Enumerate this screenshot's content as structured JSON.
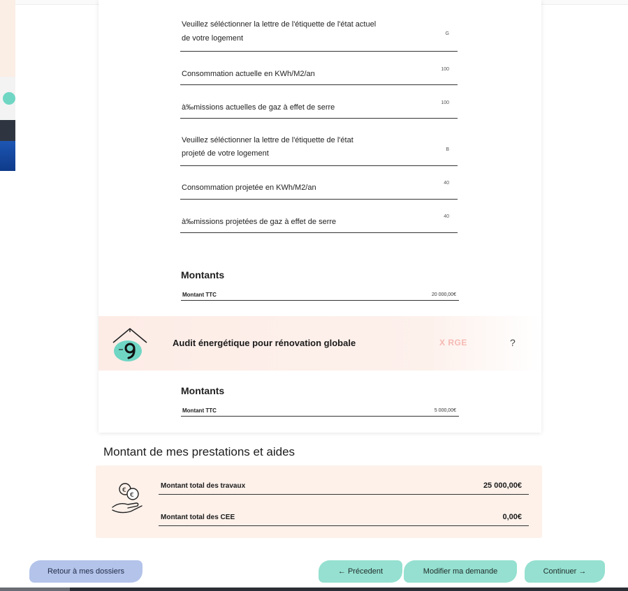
{
  "form_fields": [
    {
      "label_line1": "Veuillez séléctionner la lettre de l'étiquette de l'état actuel",
      "label_line2": "de votre logement",
      "value": "G"
    },
    {
      "label_line1": "Consommation actuelle en KWh/M2/an",
      "label_line2": "",
      "value": "100"
    },
    {
      "label_line1": "à‰missions actuelles de gaz à  effet de serre",
      "label_line2": "",
      "value": "100"
    },
    {
      "label_line1": "Veuillez séléctionner la lettre de l'étiquette de l'état",
      "label_line2": "projeté de votre logement",
      "value": "B"
    },
    {
      "label_line1": "Consommation projetée en KWh/M2/an",
      "label_line2": "",
      "value": "40"
    },
    {
      "label_line1": "à‰missions projetées de gaz à  effet de serre",
      "label_line2": "",
      "value": "40"
    }
  ],
  "section1": {
    "title": "Montants",
    "row_label": "Montant TTC",
    "row_value": "20 000,00€"
  },
  "audit": {
    "icon": "house-energy-icon",
    "title": "Audit énergétique pour rénovation globale",
    "badge": "X RGE",
    "help": "?"
  },
  "section2": {
    "title": "Montants",
    "row_label": "Montant TTC",
    "row_value": "5 000,00€"
  },
  "summary": {
    "heading": "Montant de mes prestations et aides",
    "icon": "hand-money-icon",
    "rows": [
      {
        "label": "Montant total des travaux",
        "value": "25 000,00€"
      },
      {
        "label": "Montant total des CEE",
        "value": "0,00€"
      }
    ]
  },
  "buttons": {
    "back": "Retour à mes dossiers",
    "previous": "← Précedent",
    "edit": "Modifier ma demande",
    "continue": "Continuer →"
  },
  "colors": {
    "accent_teal": "#95e0d0",
    "accent_blue": "#b3c3ea",
    "band_peach": "#fdf1ea"
  }
}
